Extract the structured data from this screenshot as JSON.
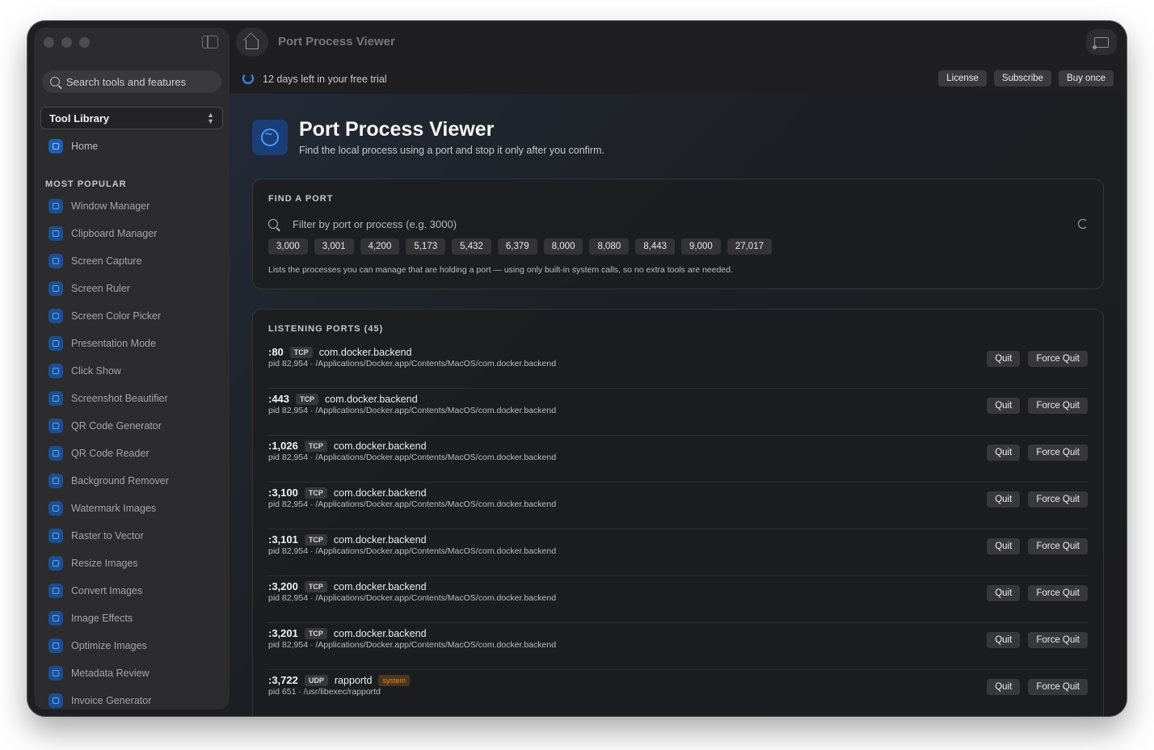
{
  "sidebar": {
    "search_placeholder": "Search tools and features",
    "library_select": "Tool Library",
    "home_label": "Home",
    "section_title": "MOST POPULAR",
    "items": [
      {
        "label": "Window Manager",
        "icon": "window-icon"
      },
      {
        "label": "Clipboard Manager",
        "icon": "clipboard-icon"
      },
      {
        "label": "Screen Capture",
        "icon": "capture-icon"
      },
      {
        "label": "Screen Ruler",
        "icon": "ruler-icon"
      },
      {
        "label": "Screen Color Picker",
        "icon": "eyedropper-icon"
      },
      {
        "label": "Presentation Mode",
        "icon": "presentation-icon"
      },
      {
        "label": "Click Show",
        "icon": "click-icon"
      },
      {
        "label": "Screenshot Beautifier",
        "icon": "beautifier-icon"
      },
      {
        "label": "QR Code Generator",
        "icon": "qr-icon"
      },
      {
        "label": "QR Code Reader",
        "icon": "qr-scan-icon"
      },
      {
        "label": "Background Remover",
        "icon": "background-remove-icon"
      },
      {
        "label": "Watermark Images",
        "icon": "drop-icon"
      },
      {
        "label": "Raster to Vector",
        "icon": "vector-icon"
      },
      {
        "label": "Resize Images",
        "icon": "resize-icon"
      },
      {
        "label": "Convert Images",
        "icon": "convert-icon"
      },
      {
        "label": "Image Effects",
        "icon": "effects-icon"
      },
      {
        "label": "Optimize Images",
        "icon": "optimize-icon"
      },
      {
        "label": "Metadata Review",
        "icon": "eye-icon"
      },
      {
        "label": "Invoice Generator",
        "icon": "invoice-icon"
      }
    ]
  },
  "titlebar": {
    "title": "Port Process Viewer"
  },
  "trial": {
    "text": "12 days left in your free trial",
    "buttons": [
      "License",
      "Subscribe",
      "Buy once"
    ]
  },
  "header": {
    "title": "Port Process Viewer",
    "subtitle": "Find the local process using a port and stop it only after you confirm."
  },
  "find": {
    "title": "FIND A PORT",
    "placeholder": "Filter by port or process (e.g. 3000)",
    "chips": [
      "3,000",
      "3,001",
      "4,200",
      "5,173",
      "5,432",
      "6,379",
      "8,000",
      "8,080",
      "8,443",
      "9,000",
      "27,017"
    ],
    "note": "Lists the processes you can manage that are holding a port — using only built-in system calls, so no extra tools are needed."
  },
  "listening": {
    "title": "LISTENING PORTS (45)",
    "quit_label": "Quit",
    "force_quit_label": "Force Quit",
    "rows": [
      {
        "port": ":80",
        "proto": "TCP",
        "process": "com.docker.backend",
        "badge": "",
        "detail": "pid 82,954 · /Applications/Docker.app/Contents/MacOS/com.docker.backend"
      },
      {
        "port": ":443",
        "proto": "TCP",
        "process": "com.docker.backend",
        "badge": "",
        "detail": "pid 82,954 · /Applications/Docker.app/Contents/MacOS/com.docker.backend"
      },
      {
        "port": ":1,026",
        "proto": "TCP",
        "process": "com.docker.backend",
        "badge": "",
        "detail": "pid 82,954 · /Applications/Docker.app/Contents/MacOS/com.docker.backend"
      },
      {
        "port": ":3,100",
        "proto": "TCP",
        "process": "com.docker.backend",
        "badge": "",
        "detail": "pid 82,954 · /Applications/Docker.app/Contents/MacOS/com.docker.backend"
      },
      {
        "port": ":3,101",
        "proto": "TCP",
        "process": "com.docker.backend",
        "badge": "",
        "detail": "pid 82,954 · /Applications/Docker.app/Contents/MacOS/com.docker.backend"
      },
      {
        "port": ":3,200",
        "proto": "TCP",
        "process": "com.docker.backend",
        "badge": "",
        "detail": "pid 82,954 · /Applications/Docker.app/Contents/MacOS/com.docker.backend"
      },
      {
        "port": ":3,201",
        "proto": "TCP",
        "process": "com.docker.backend",
        "badge": "",
        "detail": "pid 82,954 · /Applications/Docker.app/Contents/MacOS/com.docker.backend"
      },
      {
        "port": ":3,722",
        "proto": "UDP",
        "process": "rapportd",
        "badge": "system",
        "detail": "pid 651 · /usr/libexec/rapportd"
      }
    ]
  }
}
